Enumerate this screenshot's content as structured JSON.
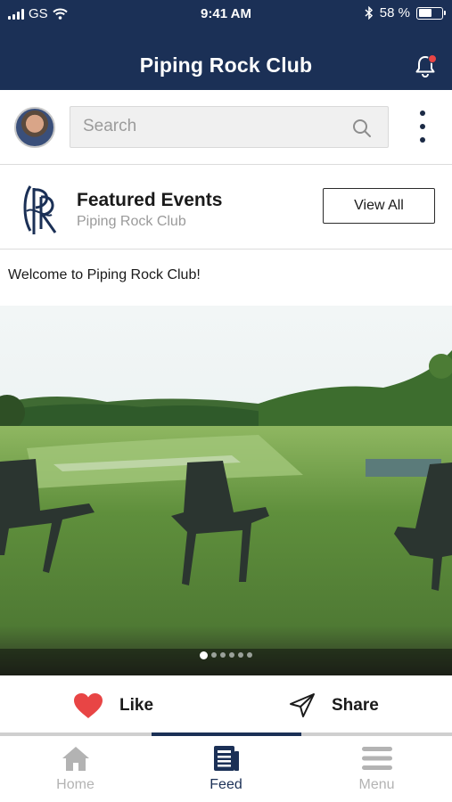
{
  "status": {
    "carrier": "GS",
    "time": "9:41 AM",
    "battery_percent": "58 %",
    "battery_level": 0.58
  },
  "header": {
    "title": "Piping Rock Club",
    "notification_dot": true
  },
  "search": {
    "placeholder": "Search",
    "value": ""
  },
  "featured": {
    "title": "Featured Events",
    "subtitle": "Piping Rock Club",
    "view_all_label": "View All"
  },
  "post": {
    "text": "Welcome to Piping Rock Club!",
    "carousel": {
      "count": 6,
      "active_index": 0
    }
  },
  "actions": {
    "like_label": "Like",
    "share_label": "Share"
  },
  "tabs": [
    {
      "label": "Home",
      "icon": "home-icon",
      "active": false
    },
    {
      "label": "Feed",
      "icon": "feed-icon",
      "active": true
    },
    {
      "label": "Menu",
      "icon": "menu-icon",
      "active": false
    }
  ],
  "colors": {
    "brand": "#1b3056",
    "like": "#e84545",
    "inactive": "#b3b3b3"
  }
}
